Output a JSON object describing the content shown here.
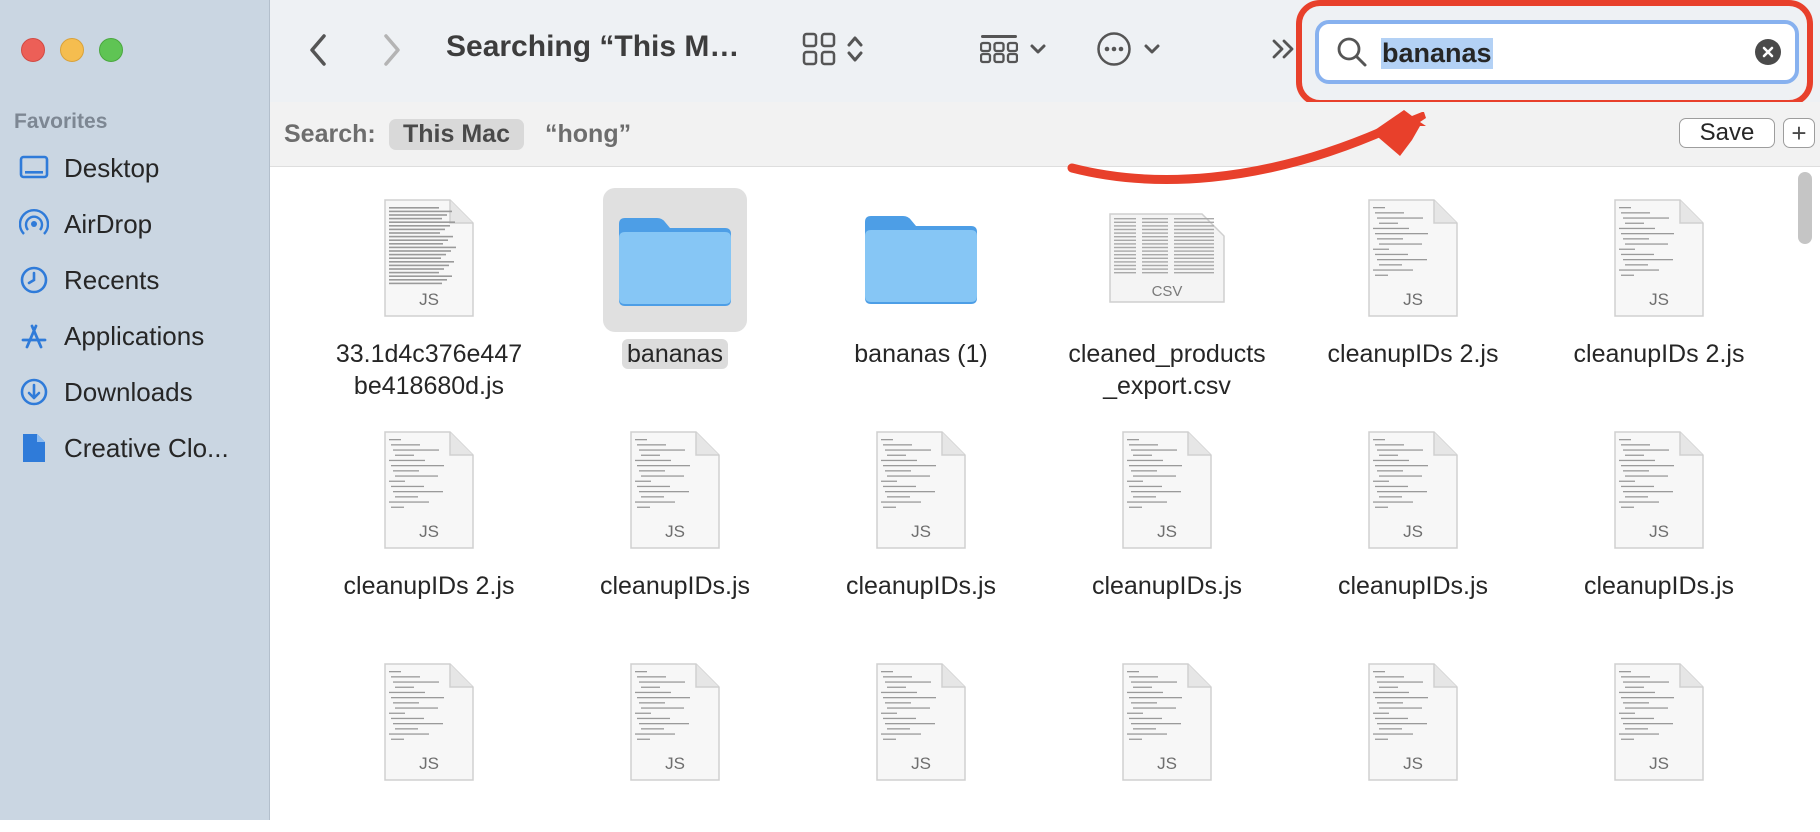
{
  "window": {
    "title": "Searching “This M…"
  },
  "sidebar": {
    "section_title": "Favorites",
    "items": [
      {
        "label": "Desktop",
        "icon": "desktop-icon"
      },
      {
        "label": "AirDrop",
        "icon": "airdrop-icon"
      },
      {
        "label": "Recents",
        "icon": "clock-icon"
      },
      {
        "label": "Applications",
        "icon": "applications-icon"
      },
      {
        "label": "Downloads",
        "icon": "download-icon"
      },
      {
        "label": "Creative Clo...",
        "icon": "document-icon"
      }
    ]
  },
  "search": {
    "value": "bananas"
  },
  "scope": {
    "label": "Search:",
    "this_mac": "This Mac",
    "other": "“hong”",
    "save": "Save",
    "add": "+"
  },
  "files": [
    {
      "name": "33.1d4c376e447be418680d.js",
      "name_lines": [
        "33.1d4c376e447",
        "be418680d.js"
      ],
      "kind": "js-dense",
      "badge": "JS"
    },
    {
      "name": "bananas",
      "name_lines": [
        "bananas"
      ],
      "kind": "folder",
      "selected": true
    },
    {
      "name": "bananas (1)",
      "name_lines": [
        "bananas (1)"
      ],
      "kind": "folder"
    },
    {
      "name": "cleaned_products_export.csv",
      "name_lines": [
        "cleaned_products",
        "_export.csv"
      ],
      "kind": "csv",
      "badge": "CSV"
    },
    {
      "name": "cleanupIDs 2.js",
      "name_lines": [
        "cleanupIDs 2.js"
      ],
      "kind": "js",
      "badge": "JS"
    },
    {
      "name": "cleanupIDs 2.js",
      "name_lines": [
        "cleanupIDs 2.js"
      ],
      "kind": "js",
      "badge": "JS"
    },
    {
      "name": "cleanupIDs 2.js",
      "name_lines": [
        "cleanupIDs 2.js"
      ],
      "kind": "js",
      "badge": "JS"
    },
    {
      "name": "cleanupIDs.js",
      "name_lines": [
        "cleanupIDs.js"
      ],
      "kind": "js",
      "badge": "JS"
    },
    {
      "name": "cleanupIDs.js",
      "name_lines": [
        "cleanupIDs.js"
      ],
      "kind": "js",
      "badge": "JS"
    },
    {
      "name": "cleanupIDs.js",
      "name_lines": [
        "cleanupIDs.js"
      ],
      "kind": "js",
      "badge": "JS"
    },
    {
      "name": "cleanupIDs.js",
      "name_lines": [
        "cleanupIDs.js"
      ],
      "kind": "js",
      "badge": "JS"
    },
    {
      "name": "cleanupIDs.js",
      "name_lines": [
        "cleanupIDs.js"
      ],
      "kind": "js",
      "badge": "JS"
    },
    {
      "name_lines": [],
      "kind": "js",
      "badge": "JS"
    },
    {
      "name_lines": [],
      "kind": "js",
      "badge": "JS"
    },
    {
      "name_lines": [],
      "kind": "js",
      "badge": "JS"
    },
    {
      "name_lines": [],
      "kind": "js",
      "badge": "JS"
    },
    {
      "name_lines": [],
      "kind": "js",
      "badge": "JS"
    },
    {
      "name_lines": [],
      "kind": "js",
      "badge": "JS"
    }
  ],
  "colors": {
    "annotation": "#e8402b",
    "folder": "#5aaef0",
    "focus_ring": "#87b1ef",
    "selection": "#b3d1f5"
  }
}
